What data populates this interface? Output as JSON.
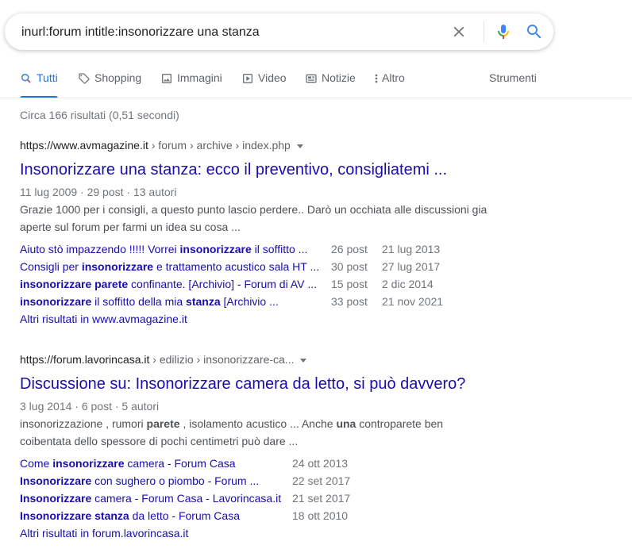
{
  "search": {
    "query": "inurl:forum intitle:insonorizzare una stanza"
  },
  "tabs": [
    {
      "label": "Tutti",
      "icon": "search-icon",
      "active": true
    },
    {
      "label": "Shopping",
      "icon": "tag-icon"
    },
    {
      "label": "Immagini",
      "icon": "image-icon"
    },
    {
      "label": "Video",
      "icon": "video-icon"
    },
    {
      "label": "Notizie",
      "icon": "news-icon"
    },
    {
      "label": "Altro",
      "icon": "more-vert-icon"
    },
    {
      "label": "Strumenti"
    }
  ],
  "stats": "Circa 166 risultati (0,51 secondi)",
  "results": [
    {
      "domain": "https://www.avmagazine.it",
      "crumbs": " › forum › archive › index.php",
      "title": "Insonorizzare una stanza: ecco il preventivo, consigliatemi ...",
      "meta": "11 lug 2009 · 29 post · 13 autori",
      "snippet": "Grazie 1000 per i consigli, a questo punto lascio perdere.. Darò un occhiata alle discussioni gia aperte sul forum per farmi un idea su cosa ...",
      "sitelinks": [
        {
          "parts": [
            {
              "t": "Aiuto stò impazzendo !!!!! Vorrei ",
              "b": false
            },
            {
              "t": "insonorizzare",
              "b": true
            },
            {
              "t": " il soffitto ...",
              "b": false
            }
          ],
          "posts": "26 post",
          "date": "21 lug 2013"
        },
        {
          "parts": [
            {
              "t": "Consigli per ",
              "b": false
            },
            {
              "t": "insonorizzare",
              "b": true
            },
            {
              "t": " e trattamento acustico sala HT ...",
              "b": false
            }
          ],
          "posts": "30 post",
          "date": "27 lug 2017"
        },
        {
          "parts": [
            {
              "t": "insonorizzare parete",
              "b": true
            },
            {
              "t": " confinante. [Archivio] - Forum di AV ...",
              "b": false
            }
          ],
          "posts": "15 post",
          "date": "2 dic 2014"
        },
        {
          "parts": [
            {
              "t": "insonorizzare",
              "b": true
            },
            {
              "t": " il soffitto della mia ",
              "b": false
            },
            {
              "t": "stanza",
              "b": true
            },
            {
              "t": " [Archivio ...",
              "b": false
            }
          ],
          "posts": "33 post",
          "date": "21 nov 2021"
        }
      ],
      "more": "Altri risultati in www.avmagazine.it"
    },
    {
      "domain": "https://forum.lavorincasa.it",
      "crumbs": " › edilizio › insonorizzare-ca...",
      "title": "Discussione su: Insonorizzare camera da letto, si può davvero?",
      "meta": "3 lug 2014 · 6 post · 5 autori",
      "snippet_parts": [
        {
          "t": "insonorizzazione , rumori ",
          "b": false
        },
        {
          "t": "parete",
          "b": true
        },
        {
          "t": " , isolamento acustico ... Anche ",
          "b": false
        },
        {
          "t": "una",
          "b": true
        },
        {
          "t": " controparete ben coibentata dello spessore di pochi centimetri può dare ...",
          "b": false
        }
      ],
      "sitelinks": [
        {
          "parts": [
            {
              "t": "Come ",
              "b": false
            },
            {
              "t": "insonorizzare",
              "b": true
            },
            {
              "t": " camera - Forum Casa",
              "b": false
            }
          ],
          "date": "24 ott 2013"
        },
        {
          "parts": [
            {
              "t": "Insonorizzare",
              "b": true
            },
            {
              "t": " con sughero o piombo - Forum ...",
              "b": false
            }
          ],
          "date": "22 set 2017"
        },
        {
          "parts": [
            {
              "t": "Insonorizzare",
              "b": true
            },
            {
              "t": " camera - Forum Casa - Lavorincasa.it",
              "b": false
            }
          ],
          "date": "21 set 2017"
        },
        {
          "parts": [
            {
              "t": "Insonorizzare stanza",
              "b": true
            },
            {
              "t": " da letto - Forum Casa",
              "b": false
            }
          ],
          "date": "18 ott 2010"
        }
      ],
      "more": "Altri risultati in forum.lavorincasa.it"
    }
  ]
}
